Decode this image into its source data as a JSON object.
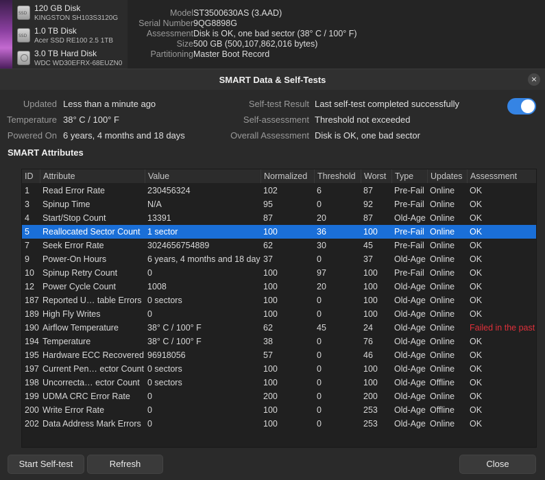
{
  "disks": [
    {
      "name": "120 GB Disk",
      "model": "KINGSTON SH103S3120G",
      "icon": "ssd-icon",
      "icon_label": "SSD"
    },
    {
      "name": "1.0 TB Disk",
      "model": "Acer SSD RE100 2.5 1TB",
      "icon": "ssd-icon",
      "icon_label": "SSD"
    },
    {
      "name": "3.0 TB Hard Disk",
      "model": "WDC WD30EFRX-68EUZN0",
      "icon": "hard-disk-icon",
      "icon_label": ""
    }
  ],
  "disk_info": [
    {
      "key": "Model",
      "value": "ST3500630AS (3.AAD)"
    },
    {
      "key": "Serial Number",
      "value": "9QG8898G"
    },
    {
      "key": "Assessment",
      "value": "Disk is OK, one bad sector (38° C / 100° F)"
    },
    {
      "key": "Size",
      "value": "500 GB (500,107,862,016 bytes)"
    },
    {
      "key": "Partitioning",
      "value": "Master Boot Record"
    }
  ],
  "dialog": {
    "title": "SMART Data & Self-Tests",
    "close_icon": "×",
    "left_summary": [
      {
        "key": "Updated",
        "value": "Less than a minute ago"
      },
      {
        "key": "Temperature",
        "value": "38° C / 100° F"
      },
      {
        "key": "Powered On",
        "value": "6 years, 4 months and 18 days"
      }
    ],
    "right_summary": [
      {
        "key": "Self-test Result",
        "value": "Last self-test completed successfully"
      },
      {
        "key": "Self-assessment",
        "value": "Threshold not exceeded"
      },
      {
        "key": "Overall Assessment",
        "value": "Disk is OK, one bad sector"
      }
    ],
    "smart_enabled": true,
    "attributes_heading": "SMART Attributes",
    "columns": [
      "ID",
      "Attribute",
      "Value",
      "Normalized",
      "Threshold",
      "Worst",
      "Type",
      "Updates",
      "Assessment"
    ],
    "rows": [
      [
        "1",
        "Read Error Rate",
        "230456324",
        "102",
        "6",
        "87",
        "Pre-Fail",
        "Online",
        "OK"
      ],
      [
        "3",
        "Spinup Time",
        "N/A",
        "95",
        "0",
        "92",
        "Pre-Fail",
        "Online",
        "OK"
      ],
      [
        "4",
        "Start/Stop Count",
        "13391",
        "87",
        "20",
        "87",
        "Old-Age",
        "Online",
        "OK"
      ],
      [
        "5",
        "Reallocated Sector Count",
        "1 sector",
        "100",
        "36",
        "100",
        "Pre-Fail",
        "Online",
        "OK"
      ],
      [
        "7",
        "Seek Error Rate",
        "3024656754889",
        "62",
        "30",
        "45",
        "Pre-Fail",
        "Online",
        "OK"
      ],
      [
        "9",
        "Power-On Hours",
        "6 years, 4 months and 18 days",
        "37",
        "0",
        "37",
        "Old-Age",
        "Online",
        "OK"
      ],
      [
        "10",
        "Spinup Retry Count",
        "0",
        "100",
        "97",
        "100",
        "Pre-Fail",
        "Online",
        "OK"
      ],
      [
        "12",
        "Power Cycle Count",
        "1008",
        "100",
        "20",
        "100",
        "Old-Age",
        "Online",
        "OK"
      ],
      [
        "187",
        "Reported U… table Errors",
        "0 sectors",
        "100",
        "0",
        "100",
        "Old-Age",
        "Online",
        "OK"
      ],
      [
        "189",
        "High Fly Writes",
        "0",
        "100",
        "0",
        "100",
        "Old-Age",
        "Online",
        "OK"
      ],
      [
        "190",
        "Airflow Temperature",
        "38° C / 100° F",
        "62",
        "45",
        "24",
        "Old-Age",
        "Online",
        "Failed in the past"
      ],
      [
        "194",
        "Temperature",
        "38° C / 100° F",
        "38",
        "0",
        "76",
        "Old-Age",
        "Online",
        "OK"
      ],
      [
        "195",
        "Hardware ECC Recovered",
        "96918056",
        "57",
        "0",
        "46",
        "Old-Age",
        "Online",
        "OK"
      ],
      [
        "197",
        "Current Pen… ector Count",
        "0 sectors",
        "100",
        "0",
        "100",
        "Old-Age",
        "Online",
        "OK"
      ],
      [
        "198",
        "Uncorrecta… ector Count",
        "0 sectors",
        "100",
        "0",
        "100",
        "Old-Age",
        "Offline",
        "OK"
      ],
      [
        "199",
        "UDMA CRC Error Rate",
        "0",
        "200",
        "0",
        "200",
        "Old-Age",
        "Online",
        "OK"
      ],
      [
        "200",
        "Write Error Rate",
        "0",
        "100",
        "0",
        "253",
        "Old-Age",
        "Offline",
        "OK"
      ],
      [
        "202",
        "Data Address Mark Errors",
        "0",
        "100",
        "0",
        "253",
        "Old-Age",
        "Online",
        "OK"
      ]
    ],
    "selected_row": 3,
    "warning_color": "#e0303a",
    "selection_color": "#1a6fd8",
    "accent_color": "#3584e4",
    "buttons": {
      "start_self_test": "Start Self-test",
      "refresh": "Refresh",
      "close": "Close"
    }
  }
}
